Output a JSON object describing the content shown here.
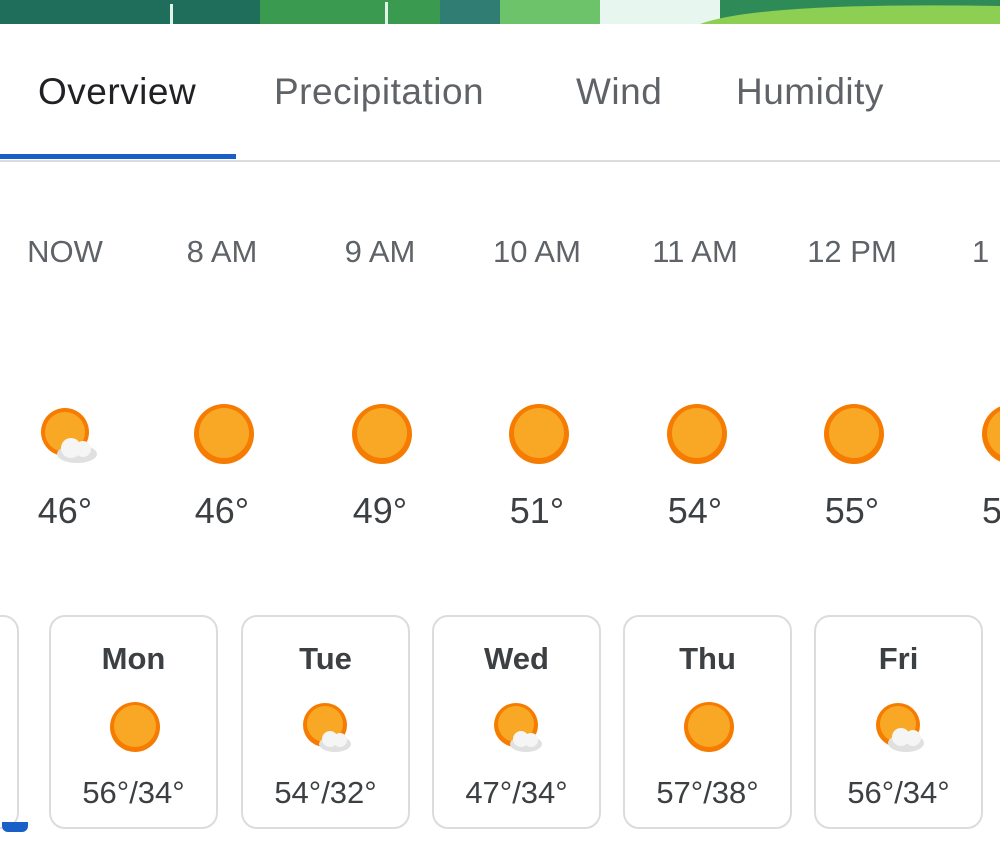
{
  "tabs": [
    {
      "label": "Overview",
      "active": true
    },
    {
      "label": "Precipitation",
      "active": false
    },
    {
      "label": "Wind",
      "active": false
    },
    {
      "label": "Humidity",
      "active": false
    }
  ],
  "hourly": [
    {
      "time": "NOW",
      "temp": "46°",
      "icon": "partly-sunny-icon"
    },
    {
      "time": "8 AM",
      "temp": "46°",
      "icon": "sun-icon"
    },
    {
      "time": "9 AM",
      "temp": "49°",
      "icon": "sun-icon"
    },
    {
      "time": "10 AM",
      "temp": "51°",
      "icon": "sun-icon"
    },
    {
      "time": "11 AM",
      "temp": "54°",
      "icon": "sun-icon"
    },
    {
      "time": "12 PM",
      "temp": "55°",
      "icon": "sun-icon"
    },
    {
      "time": "1",
      "temp": "5",
      "icon": "sun-icon"
    }
  ],
  "daily": [
    {
      "day": "Mon",
      "temps": "56°/34°",
      "icon": "sun-icon"
    },
    {
      "day": "Tue",
      "temps": "54°/32°",
      "icon": "partly-sunny-icon"
    },
    {
      "day": "Wed",
      "temps": "47°/34°",
      "icon": "partly-sunny-icon"
    },
    {
      "day": "Thu",
      "temps": "57°/38°",
      "icon": "sun-icon"
    },
    {
      "day": "Fri",
      "temps": "56°/34°",
      "icon": "partly-sunny-icon"
    }
  ],
  "colors": {
    "accent": "#1a5fc8",
    "sun": "#f9a825",
    "sun_dark": "#f57c00"
  }
}
